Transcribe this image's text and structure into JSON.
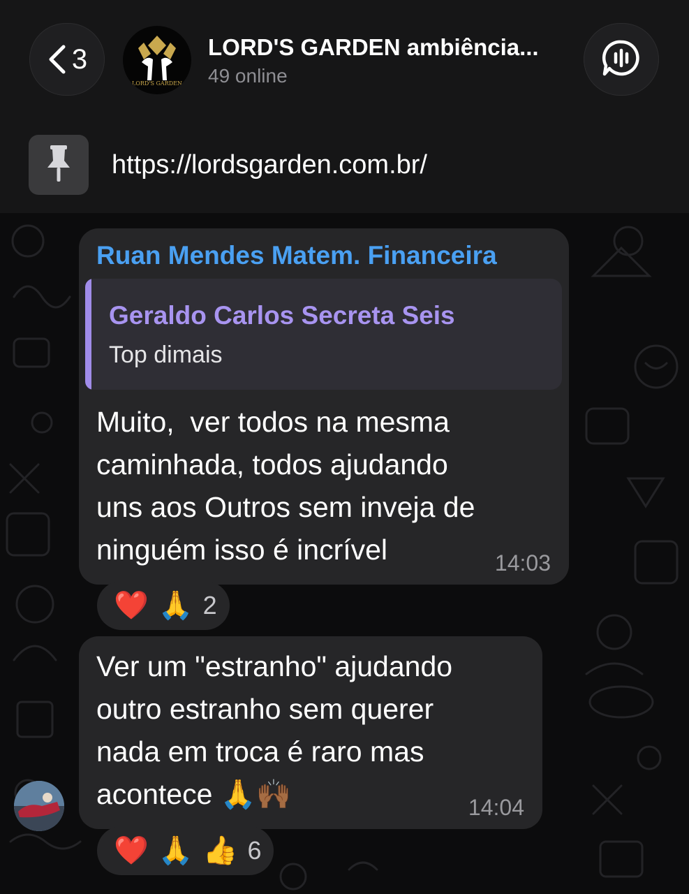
{
  "header": {
    "back_count": "3",
    "title": "LORD'S GARDEN ambiência...",
    "subtitle": "49 online",
    "avatar_logo_text": "LORD'S GARDEN"
  },
  "pinned": {
    "text": "https://lordsgarden.com.br/"
  },
  "messages": [
    {
      "sender": "Ruan Mendes Matem. Financeira",
      "reply": {
        "name": "Geraldo Carlos Secreta Seis",
        "text": "Top dimais"
      },
      "text": "Muito,  ver todos na mesma\ncaminhada, todos ajudando\nuns aos Outros sem inveja de\nninguém isso é incrível",
      "time": "14:03",
      "reactions": {
        "emojis": [
          "❤️",
          "🙏"
        ],
        "count": "2"
      }
    },
    {
      "text": "Ver um \"estranho\" ajudando\noutro estranho sem querer\nnada em troca é raro mas\nacontece 🙏🙌🏾",
      "time": "14:04",
      "reactions": {
        "emojis": [
          "❤️",
          "🙏",
          "👍"
        ],
        "count": "6"
      }
    }
  ],
  "icons": {
    "back": "chevron-left-icon",
    "voice_chat": "voice-chat-icon",
    "pin": "pin-icon"
  },
  "colors": {
    "sender_name": "#4aa0f2",
    "reply_name": "#a894f0",
    "bubble": "#262628"
  }
}
